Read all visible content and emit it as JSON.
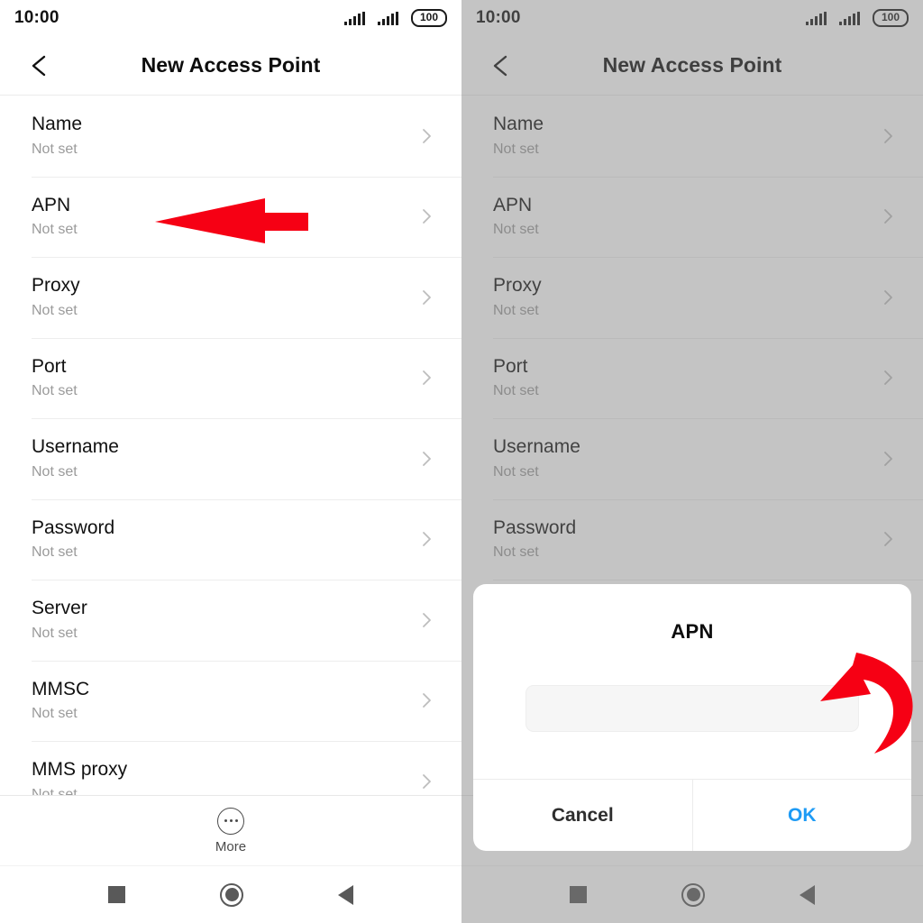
{
  "status_bar": {
    "time": "10:00",
    "battery_level": "100",
    "signal_icon_1": "signal-bars-icon",
    "signal_icon_2": "signal-bars-icon",
    "battery_icon": "battery-icon"
  },
  "app_bar": {
    "back_icon": "chevron-left-icon",
    "title": "New Access Point"
  },
  "settings_rows": [
    {
      "label": "Name",
      "value": "Not set",
      "chevron": "chevron-right-icon"
    },
    {
      "label": "APN",
      "value": "Not set",
      "chevron": "chevron-right-icon"
    },
    {
      "label": "Proxy",
      "value": "Not set",
      "chevron": "chevron-right-icon"
    },
    {
      "label": "Port",
      "value": "Not set",
      "chevron": "chevron-right-icon"
    },
    {
      "label": "Username",
      "value": "Not set",
      "chevron": "chevron-right-icon"
    },
    {
      "label": "Password",
      "value": "Not set",
      "chevron": "chevron-right-icon"
    },
    {
      "label": "Server",
      "value": "Not set",
      "chevron": "chevron-right-icon"
    },
    {
      "label": "MMSC",
      "value": "Not set",
      "chevron": "chevron-right-icon"
    },
    {
      "label": "MMS proxy",
      "value": "Not set",
      "chevron": "chevron-right-icon"
    }
  ],
  "more_bar": {
    "icon": "overflow-dots-circle-icon",
    "label": "More"
  },
  "nav_bar": {
    "recents_icon": "square-recents-icon",
    "home_icon": "circle-home-icon",
    "back_icon": "triangle-back-icon"
  },
  "dialog": {
    "title": "APN",
    "input_value": "",
    "input_placeholder": "",
    "cancel_label": "Cancel",
    "ok_label": "OK"
  },
  "annotations": {
    "left_arrow_icon": "red-left-arrow-icon",
    "curved_arrow_icon": "red-curved-arrow-icon",
    "accent_red": "#F60014",
    "accent_blue": "#1E9BF5"
  }
}
